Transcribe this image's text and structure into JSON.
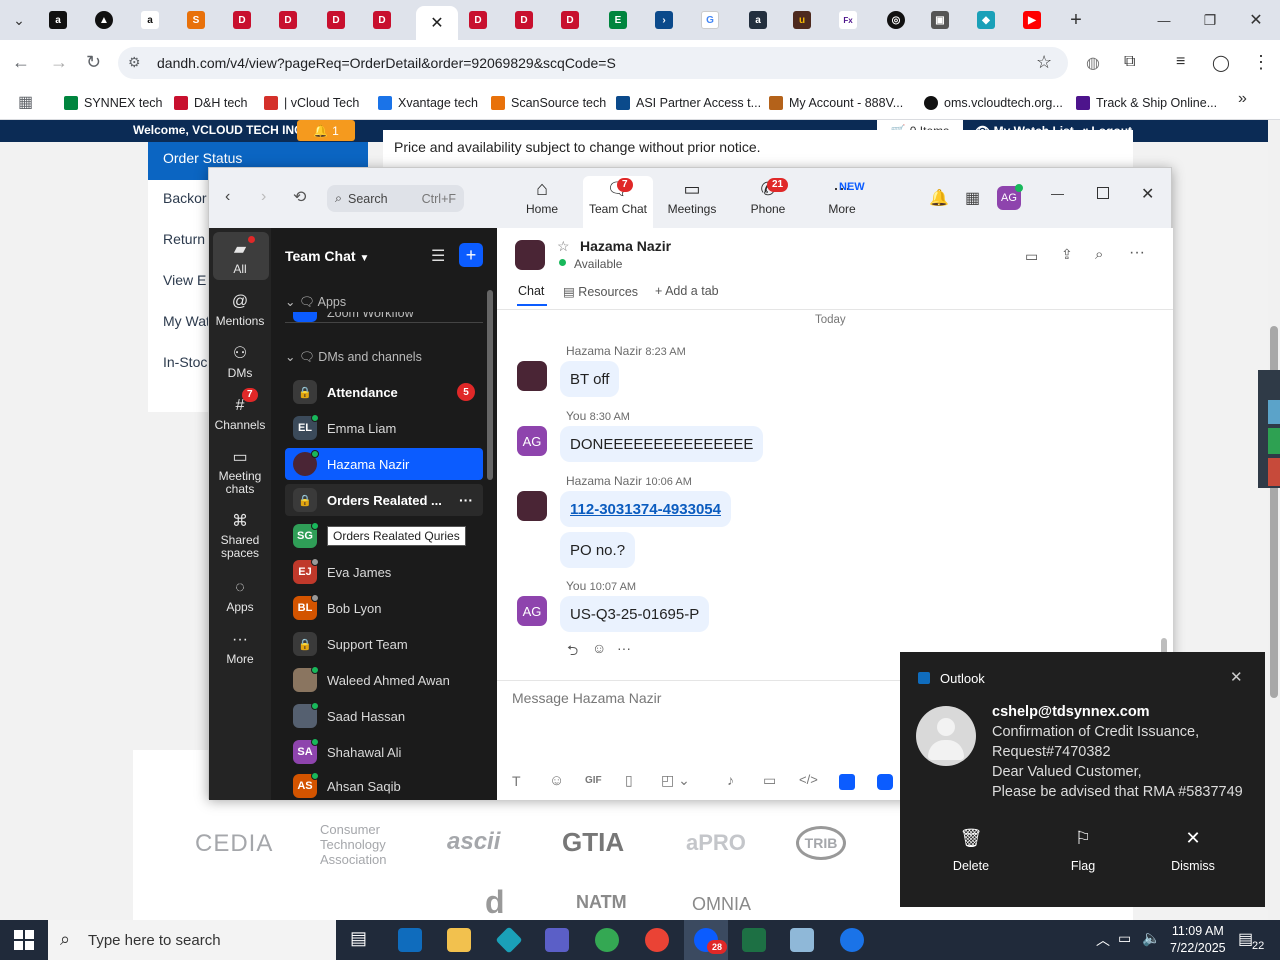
{
  "browser": {
    "url": "dandh.com/v4/view?pageReq=OrderDetail&order=92069829&scqCode=S",
    "bookmarks": [
      {
        "label": "SYNNEX tech",
        "color": "#00853e"
      },
      {
        "label": "D&H tech",
        "color": "#c8102e"
      },
      {
        "label": "| vCloud Tech",
        "color": "#d4302a"
      },
      {
        "label": "Xvantage tech",
        "color": "#1a73e8"
      },
      {
        "label": "ScanSource tech",
        "color": "#e8710a"
      },
      {
        "label": "ASI Partner Access t...",
        "color": "#0b4a8b"
      },
      {
        "label": "My Account - 888V...",
        "color": "#b4621a"
      },
      {
        "label": "oms.vcloudtech.org...",
        "color": "#111111"
      },
      {
        "label": "Track & Ship Online...",
        "color": "#4d148c"
      }
    ]
  },
  "site": {
    "welcome": "Welcome, VCLOUD TECH INC",
    "alert_count": "1",
    "cart": "0 Items",
    "watchlist": "My Watch List",
    "logout": "Logout",
    "notice": "Price and availability subject to change without prior notice.",
    "side_links": [
      "Order Status",
      "Backor",
      "Return",
      "View E",
      "My Wat",
      "In-Stoc"
    ],
    "logos": [
      "CEDIA",
      "Consumer Technology Association",
      "ascii",
      "GTIA",
      "aPRO",
      "TRIB",
      "NATM",
      "OMNIA"
    ]
  },
  "zoom": {
    "search_placeholder": "Search",
    "search_shortcut": "Ctrl+F",
    "nav": [
      {
        "label": "Home",
        "badge": ""
      },
      {
        "label": "Team Chat",
        "badge": "7"
      },
      {
        "label": "Meetings",
        "badge": ""
      },
      {
        "label": "Phone",
        "badge": "21"
      },
      {
        "label": "More",
        "badge": "NEW"
      }
    ],
    "profile_initials": "AG",
    "rail": [
      {
        "label": "All",
        "badge": ""
      },
      {
        "label": "Mentions",
        "badge": ""
      },
      {
        "label": "DMs",
        "badge": ""
      },
      {
        "label": "Channels",
        "badge": "7"
      },
      {
        "label": "Meeting chats",
        "badge": ""
      },
      {
        "label": "Shared spaces",
        "badge": ""
      },
      {
        "label": "Apps",
        "badge": ""
      },
      {
        "label": "More",
        "badge": ""
      }
    ],
    "list_title": "Team Chat",
    "section_apps": "Apps",
    "apps_partial": "Zoom Workflow",
    "section_dms": "DMs and channels",
    "contacts": [
      {
        "name": "Attendance",
        "initials": "",
        "color": "#3a3a3a",
        "bold": true,
        "badge": "5",
        "status": "lock"
      },
      {
        "name": "Emma Liam",
        "initials": "EL",
        "color": "#3b4a5a",
        "bold": false,
        "badge": "",
        "status": "online"
      },
      {
        "name": "Hazama Nazir",
        "initials": "",
        "color": "#4a2535",
        "bold": false,
        "badge": "",
        "status": "online",
        "selected": true
      },
      {
        "name": "Orders Realated ...",
        "initials": "",
        "color": "#3a3a3a",
        "bold": true,
        "badge": "",
        "status": "lock"
      },
      {
        "name": "",
        "initials": "SG",
        "color": "#2f9e57",
        "bold": false,
        "badge": "",
        "status": "online"
      },
      {
        "name": "Eva James",
        "initials": "EJ",
        "color": "#c0392b",
        "bold": false,
        "badge": "",
        "status": "away"
      },
      {
        "name": "Bob Lyon",
        "initials": "BL",
        "color": "#d35400",
        "bold": false,
        "badge": "",
        "status": "away"
      },
      {
        "name": "Support Team",
        "initials": "",
        "color": "#3a3a3a",
        "bold": false,
        "badge": "",
        "status": "lock"
      },
      {
        "name": "Waleed Ahmed Awan",
        "initials": "",
        "color": "#8a7560",
        "bold": false,
        "badge": "",
        "status": "online"
      },
      {
        "name": "Saad Hassan",
        "initials": "",
        "color": "#556070",
        "bold": false,
        "badge": "",
        "status": "online"
      },
      {
        "name": "Shahawal Ali",
        "initials": "SA",
        "color": "#8e44ad",
        "bold": false,
        "badge": "",
        "status": "online"
      },
      {
        "name": "Ahsan Saqib",
        "initials": "AS",
        "color": "#d35400",
        "bold": false,
        "badge": "",
        "status": "online"
      }
    ],
    "tooltip": "Orders Realated Quries",
    "chat": {
      "contact_name": "Hazama Nazir",
      "contact_status": "Available",
      "tabs": [
        "Chat",
        "Resources",
        "Add a tab"
      ],
      "day_label": "Today",
      "messages": [
        {
          "sender": "Hazama Nazir",
          "time": "8:23 AM",
          "text": "BT off",
          "mine": false
        },
        {
          "sender": "You",
          "time": "8:30 AM",
          "text": "DONEEEEEEEEEEEEEEE",
          "mine": true
        },
        {
          "sender": "Hazama Nazir",
          "time": "10:06 AM",
          "text": "112-3031374-4933054",
          "mine": false,
          "link": true
        },
        {
          "sender": "",
          "time": "",
          "text": "PO no.?",
          "mine": false
        },
        {
          "sender": "You",
          "time": "10:07 AM",
          "text": "US-Q3-25-01695-P",
          "mine": true
        }
      ],
      "composer_placeholder": "Message Hazama Nazir",
      "composer_tools": [
        "T",
        "☺",
        "GIF"
      ]
    }
  },
  "toast": {
    "app": "Outlook",
    "sender": "cshelp@tdsynnex.com",
    "lines": [
      "Confirmation of Credit Issuance,",
      "Request#7470382",
      "Dear Valued Customer,",
      "Please be advised that RMA #5837749"
    ],
    "actions": [
      "Delete",
      "Flag",
      "Dismiss"
    ]
  },
  "taskbar": {
    "search_placeholder": "Type here to search",
    "time": "11:09 AM",
    "date": "7/22/2025",
    "notification_count": "22",
    "zoom_badge": "28"
  }
}
